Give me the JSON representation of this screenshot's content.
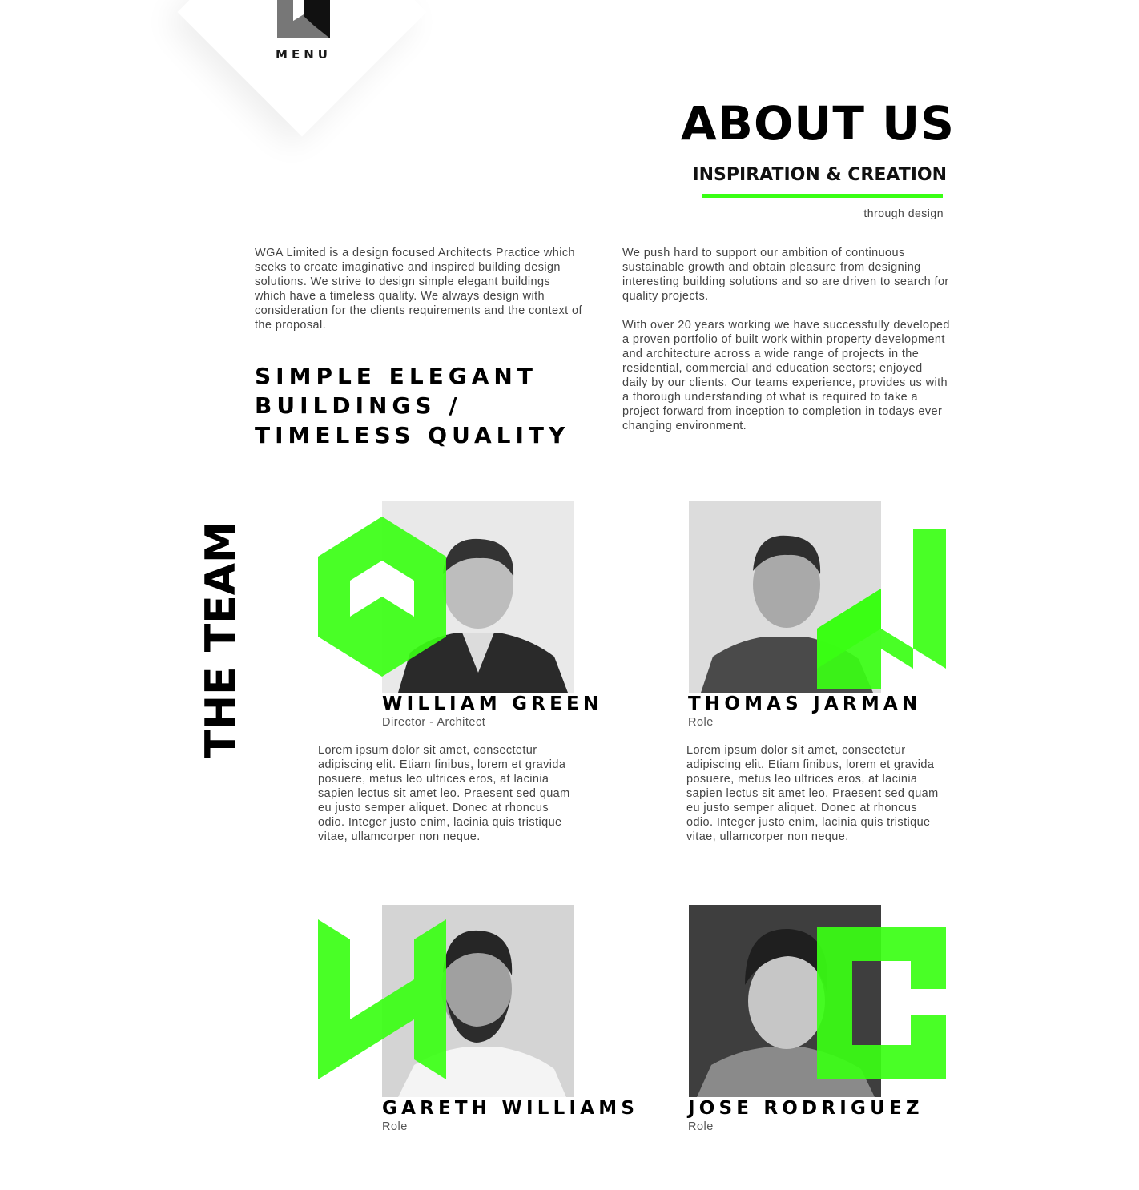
{
  "brand": {
    "accent_color": "#39ff14",
    "logo_icon": "wga-logo-icon"
  },
  "menu": {
    "label": "MENU"
  },
  "header": {
    "title": "ABOUT US",
    "subtitle": "INSPIRATION & CREATION",
    "tagline": "through design"
  },
  "intro": {
    "left_paragraph": "WGA Limited is a design focused Architects Practice which seeks to create imaginative and inspired building design solutions. We strive to design simple elegant buildings which have a timeless quality. We always design with consideration for the clients requirements and the context of the proposal.",
    "heading_lines": [
      "SIMPLE ELEGANT",
      "BUILDINGS /",
      "TIMELESS QUALITY"
    ],
    "right_paragraphs": [
      "We push hard to support our ambition of continuous sustainable growth and obtain pleasure from designing interesting building solutions and so are driven to search for quality projects.",
      "With over 20 years working we have successfully developed a proven portfolio of built work within property development and architecture across a wide range of projects in the residential, commercial and education sectors; enjoyed daily by our clients. Our teams experience, provides us with a thorough understanding of what is required to take a project forward from inception to completion in todays ever changing environment."
    ]
  },
  "team": {
    "title": "THE TEAM",
    "members": [
      {
        "name": "WILLIAM GREEN",
        "role": "Director - Architect",
        "bio": "Lorem ipsum dolor sit amet, consectetur adipiscing elit. Etiam finibus, lorem et gravida posuere, metus leo ultrices eros, at lacinia sapien lectus sit amet leo. Praesent sed quam eu justo semper aliquet. Donec at rhoncus odio. Integer justo enim, lacinia quis tristique vitae, ullamcorper non neque.",
        "letter_icon": "letter-a-icon"
      },
      {
        "name": "THOMAS JARMAN",
        "role": "Role",
        "bio": "Lorem ipsum dolor sit amet, consectetur adipiscing elit. Etiam finibus, lorem et gravida posuere, metus leo ultrices eros, at lacinia sapien lectus sit amet leo. Praesent sed quam eu justo semper aliquet. Donec at rhoncus odio. Integer justo enim, lacinia quis tristique vitae, ullamcorper non neque.",
        "letter_icon": "letter-n-icon"
      },
      {
        "name": "GARETH WILLIAMS",
        "role": "Role",
        "letter_icon": "letter-w-icon"
      },
      {
        "name": "JOSE RODRIGUEZ",
        "role": "Role",
        "letter_icon": "letter-c-icon"
      }
    ]
  }
}
